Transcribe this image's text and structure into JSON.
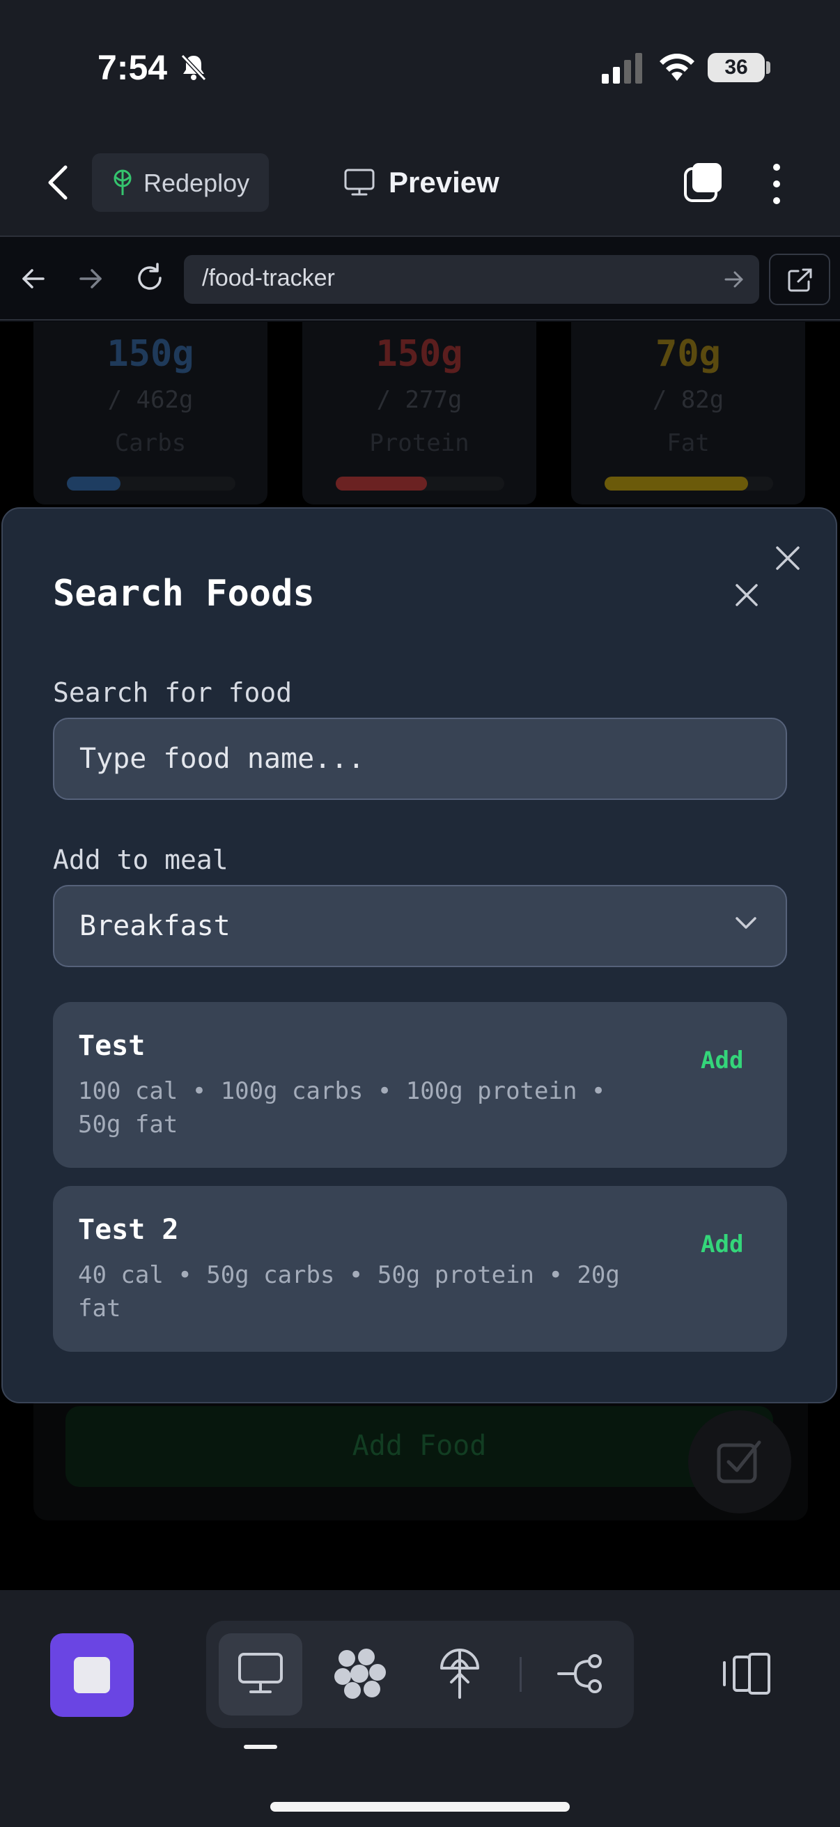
{
  "status_bar": {
    "time": "7:54",
    "battery": "36"
  },
  "header": {
    "redeploy_label": "Redeploy",
    "title": "Preview"
  },
  "browser": {
    "url": "/food-tracker"
  },
  "background": {
    "macros": [
      {
        "value": "150g",
        "goal": "/ 462g",
        "name": "Carbs",
        "color": "#1f3a5a",
        "fill_color": "#1e3d61",
        "progress": 0.32
      },
      {
        "value": "150g",
        "goal": "/ 277g",
        "name": "Protein",
        "color": "#5b1e1e",
        "fill_color": "#6b2222",
        "progress": 0.54
      },
      {
        "value": "70g",
        "goal": "/ 82g",
        "name": "Fat",
        "color": "#5a4a0f",
        "fill_color": "#6b5a0a",
        "progress": 0.85
      }
    ],
    "add_food_label": "Add Food"
  },
  "modal": {
    "title": "Search Foods",
    "search_label": "Search for food",
    "search_placeholder": "Type food name...",
    "meal_label": "Add to meal",
    "meal_selected": "Breakfast",
    "results": [
      {
        "name": "Test",
        "meta": "100 cal • 100g carbs • 100g protein • 50g fat",
        "action": "Add"
      },
      {
        "name": "Test 2",
        "meta": "40 cal • 50g carbs • 50g protein • 20g fat",
        "action": "Add"
      }
    ]
  },
  "colors": {
    "accent": "#6a45e3",
    "add_green": "#34d67a",
    "modal_bg": "#1f2938"
  }
}
